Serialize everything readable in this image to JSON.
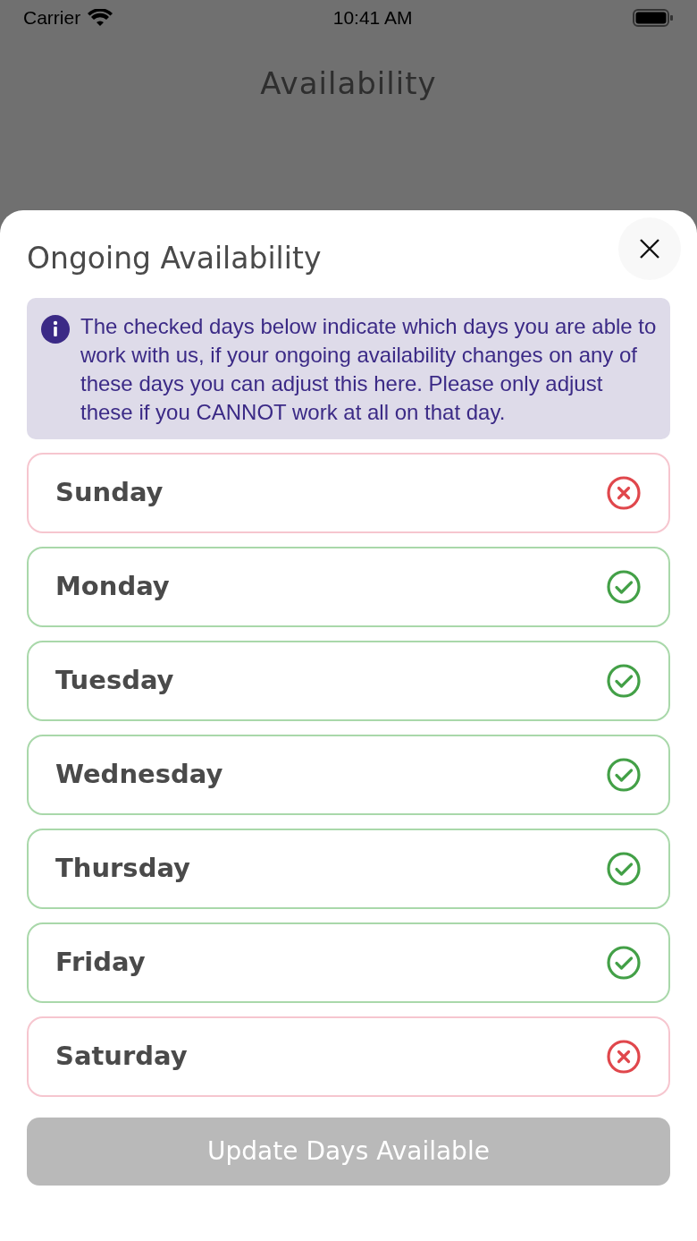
{
  "status_bar": {
    "carrier": "Carrier",
    "time": "10:41 AM"
  },
  "background": {
    "title": "Availability"
  },
  "sheet": {
    "title": "Ongoing Availability",
    "info": "The checked days below indicate which days you are able to work with us, if your ongoing availability changes on any of these days you can adjust this here. Please only adjust these if you CANNOT work at all on that day.",
    "days": [
      {
        "label": "Sunday",
        "available": false
      },
      {
        "label": "Monday",
        "available": true
      },
      {
        "label": "Tuesday",
        "available": true
      },
      {
        "label": "Wednesday",
        "available": true
      },
      {
        "label": "Thursday",
        "available": true
      },
      {
        "label": "Friday",
        "available": true
      },
      {
        "label": "Saturday",
        "available": false
      }
    ],
    "button": {
      "label": "Update Days Available",
      "disabled": true
    }
  }
}
